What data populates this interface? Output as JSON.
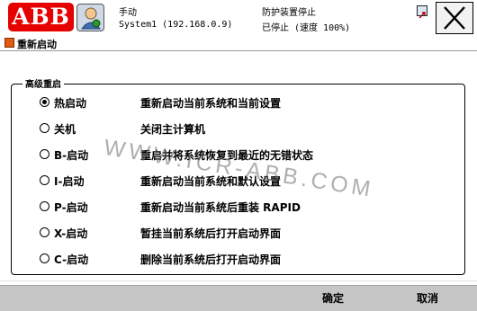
{
  "header": {
    "logo_text": "ABB",
    "status": {
      "mode": "手动",
      "system": "System1 (192.168.0.9)",
      "safety": "防护装置停止",
      "run_state": "已停止 (速度 100%)"
    }
  },
  "window": {
    "title": "重新启动"
  },
  "group": {
    "legend": "高级重启",
    "options": [
      {
        "label": "热启动",
        "desc": "重新启动当前系统和当前设置",
        "selected": true
      },
      {
        "label": "关机",
        "desc": "关闭主计算机",
        "selected": false
      },
      {
        "label": "B-启动",
        "desc": "重启并将系统恢复到最近的无错状态",
        "selected": false
      },
      {
        "label": "I-启动",
        "desc": "重新启动当前系统和默认设置",
        "selected": false
      },
      {
        "label": "P-启动",
        "desc": "重新启动当前系统后重装 RAPID",
        "selected": false
      },
      {
        "label": "X-启动",
        "desc": "暂挂当前系统后打开启动界面",
        "selected": false
      },
      {
        "label": "C-启动",
        "desc": "删除当前系统后打开启动界面",
        "selected": false
      }
    ]
  },
  "watermark": "WWW.ICR-ABB.COM",
  "footer": {
    "ok_label": "确定",
    "cancel_label": "取消"
  },
  "colors": {
    "logo_red": "#e60000",
    "bottom_bar": "#c6c6c6"
  }
}
